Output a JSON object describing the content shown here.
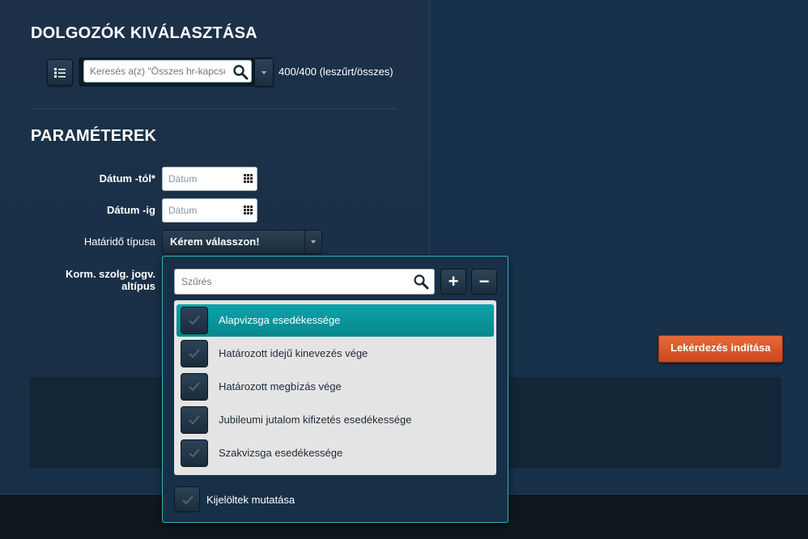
{
  "employees": {
    "title": "DOLGOZÓK KIVÁLASZTÁSA",
    "search_placeholder": "Keresés a(z) \"Összes hr-kapcsolat\"",
    "count_text": "400/400 (leszűrt/összes)"
  },
  "parameters": {
    "title": "PARAMÉTEREK",
    "date_from_label": "Dátum -tól*",
    "date_from_placeholder": "Dátum",
    "date_to_label": "Dátum -ig",
    "date_to_placeholder": "Dátum",
    "deadline_type_label": "Határidő típusa",
    "deadline_type_value": "Kérem válasszon!",
    "subtype_label": "Korm. szolg. jogv. altípus"
  },
  "query_button": "Lekérdezés indítása",
  "dropdown": {
    "filter_placeholder": "Szűrés",
    "add_label": "+",
    "remove_label": "−",
    "items": [
      {
        "label": "Alapvizsga esedékessége",
        "selected": true
      },
      {
        "label": "Határozott idejű kinevezés vége",
        "selected": false
      },
      {
        "label": "Határozott megbízás vége",
        "selected": false
      },
      {
        "label": "Jubileumi jutalom kifizetés esedékessége",
        "selected": false
      },
      {
        "label": "Szakvizsga esedékessége",
        "selected": false
      }
    ],
    "show_selected_label": "Kijelöltek mutatása"
  },
  "colors": {
    "accent_teal": "#0ca3a9",
    "query_orange": "#e0592b",
    "panel_bg": "#1c3148"
  }
}
